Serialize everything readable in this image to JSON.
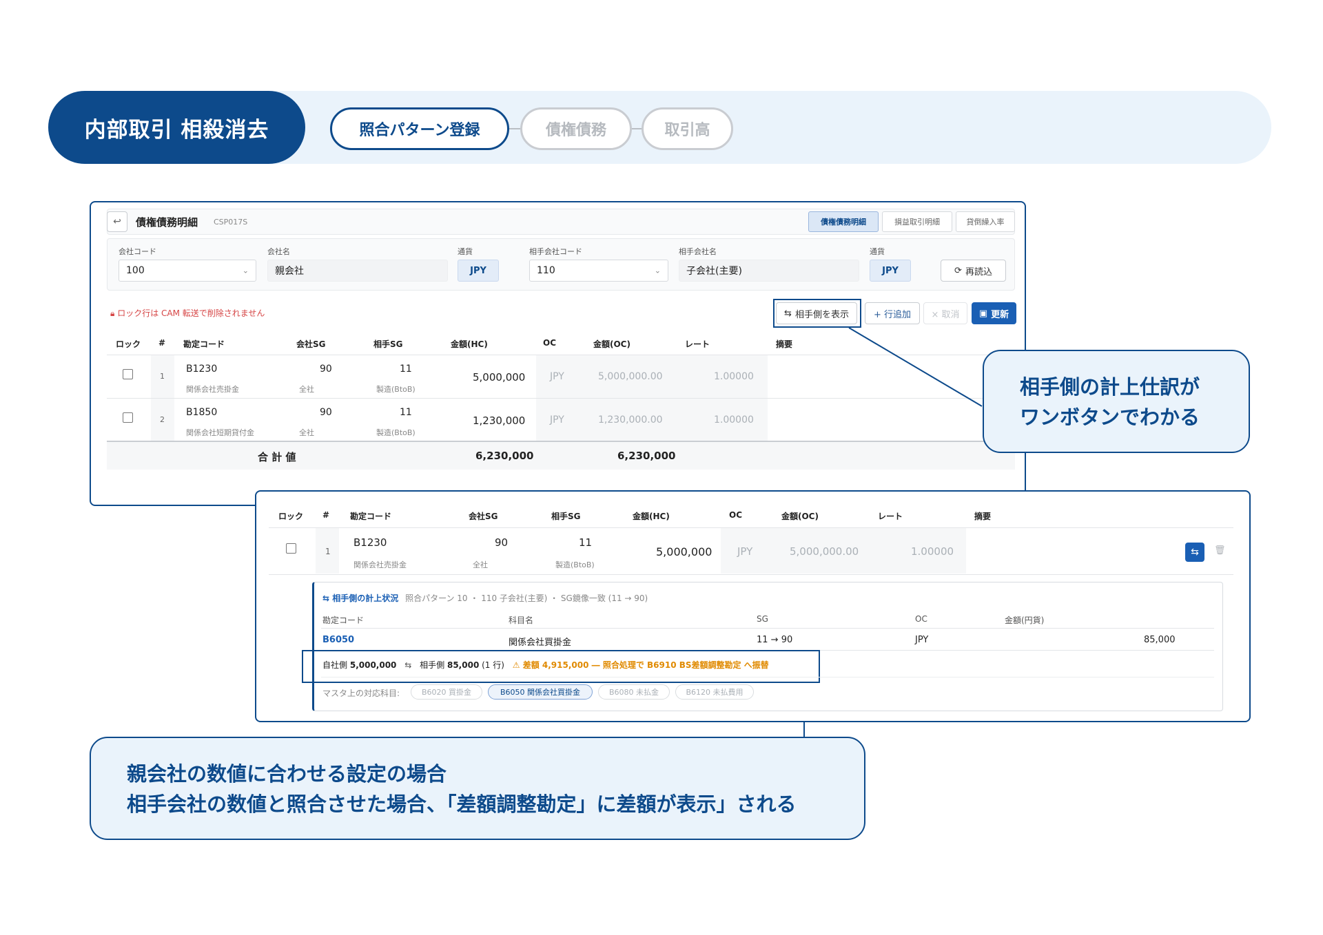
{
  "header": {
    "title": "内部取引 相殺消去",
    "steps": [
      "照合パターン登録",
      "債権債務",
      "取引高"
    ]
  },
  "screen": {
    "title": "債権債務明細",
    "code": "CSP017S",
    "tabs": [
      "債権債務明細",
      "損益取引明細",
      "貸倒繰入率"
    ],
    "fields": {
      "company_code_label": "会社コード",
      "company_code": "100",
      "company_name_label": "会社名",
      "company_name": "親会社",
      "currency_label": "通貨",
      "currency": "JPY",
      "partner_code_label": "相手会社コード",
      "partner_code": "110",
      "partner_name_label": "相手会社名",
      "partner_name": "子会社(主要)",
      "currency2_label": "通貨",
      "currency2": "JPY"
    },
    "reload_label": "再読込",
    "lock_warning": "ロック行は CAM 転送で削除されません",
    "actions": {
      "show_partner": "相手側を表示",
      "add_row": "+ 行追加",
      "cancel": "× 取消",
      "update": "更新"
    },
    "columns": [
      "ロック",
      "#",
      "勘定コード",
      "会社SG",
      "相手SG",
      "金額(HC)",
      "OC",
      "金額(OC)",
      "レート",
      "摘要"
    ],
    "rows": [
      {
        "no": "1",
        "code": "B1230",
        "name": "関係会社売掛金",
        "company_sg": "90",
        "company_sg_sub": "全社",
        "partner_sg": "11",
        "partner_sg_sub": "製造(BtoB)",
        "amount_hc": "5,000,000",
        "oc": "JPY",
        "amount_oc": "5,000,000.00",
        "rate": "1.00000"
      },
      {
        "no": "2",
        "code": "B1850",
        "name": "関係会社短期貸付金",
        "company_sg": "90",
        "company_sg_sub": "全社",
        "partner_sg": "11",
        "partner_sg_sub": "製造(BtoB)",
        "amount_hc": "1,230,000",
        "oc": "JPY",
        "amount_oc": "1,230,000.00",
        "rate": "1.00000"
      }
    ],
    "total_label": "合 計 値",
    "total_hc": "6,230,000",
    "total_oc": "6,230,000"
  },
  "detail": {
    "row": {
      "no": "1",
      "code": "B1230",
      "name": "関係会社売掛金",
      "company_sg": "90",
      "company_sg_sub": "全社",
      "partner_sg": "11",
      "partner_sg_sub": "製造(BtoB)",
      "amount_hc": "5,000,000",
      "oc": "JPY",
      "amount_oc": "5,000,000.00",
      "rate": "1.00000"
    },
    "partner_title": "相手側の計上状況",
    "partner_meta": "照合パターン 10 ・ 110 子会社(主要) ・ SG鏡像一致 (11 → 90)",
    "sub_columns": [
      "勘定コード",
      "科目名",
      "SG",
      "OC",
      "金額(円貨)"
    ],
    "sub_row": {
      "code": "B6050",
      "name": "関係会社買掛金",
      "sg": "11 → 90",
      "oc": "JPY",
      "amount": "85,000"
    },
    "summary_self_label": "自社側",
    "summary_self": "5,000,000",
    "summary_partner_label": "相手側",
    "summary_partner": "85,000",
    "summary_lines": "(1 行)",
    "summary_warning": "⚠ 差額 4,915,000 ― 照合処理で B6910 BS差額調整勘定 へ振替",
    "master_label": "マスタ上の対応科目:",
    "chips": [
      "B6020 買掛金",
      "B6050 関係会社買掛金",
      "B6080 未払金",
      "B6120 未払費用"
    ]
  },
  "callouts": {
    "right_line1": "相手側の計上仕訳が",
    "right_line2": "ワンボタンでわかる",
    "bottom_line1": "親会社の数値に合わせる設定の場合",
    "bottom_line2": "相手会社の数値と照合させた場合、「差額調整勘定」に差額が表示」される"
  },
  "colors": {
    "brand": "#0d4a8b",
    "accent": "#1a5fb4",
    "warning": "#e08a00",
    "lock_warning": "#d64545"
  }
}
